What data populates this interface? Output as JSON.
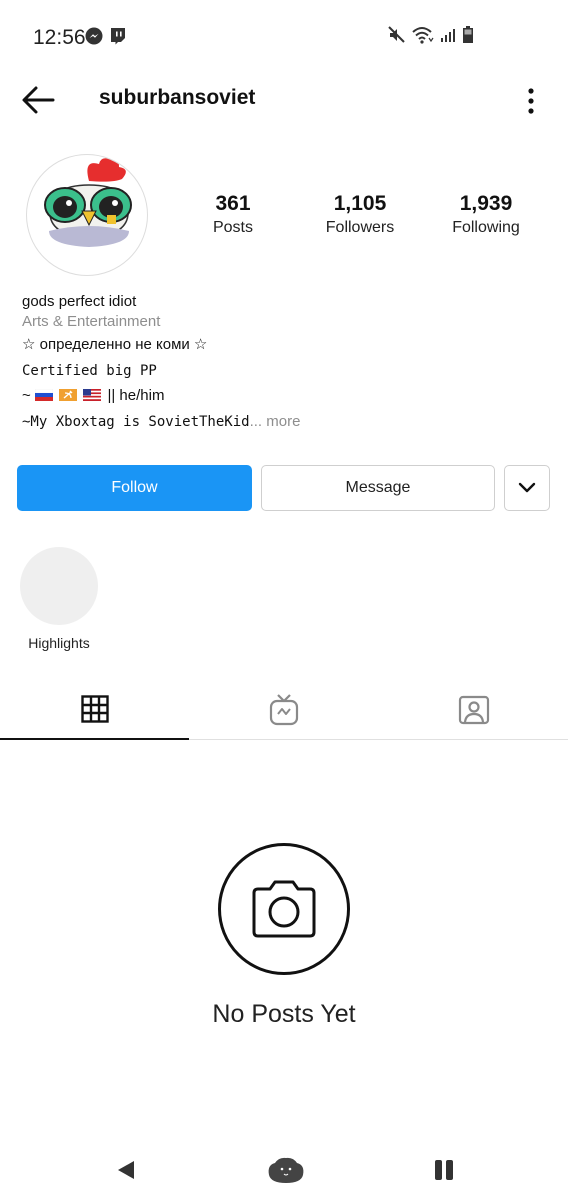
{
  "status_bar": {
    "time": "12:56",
    "left_icons": [
      "messenger-icon",
      "twitch-icon"
    ],
    "right_icons": [
      "mute-icon",
      "wifi-icon",
      "signal-icon",
      "battery-icon"
    ]
  },
  "header": {
    "username": "suburbansoviet",
    "back_icon": "arrow-left-icon",
    "menu_icon": "more-vertical-icon"
  },
  "profile": {
    "stats": [
      {
        "value": "361",
        "label": "Posts"
      },
      {
        "value": "1,105",
        "label": "Followers"
      },
      {
        "value": "1,939",
        "label": "Following"
      }
    ],
    "bio": {
      "name": "gods perfect idiot",
      "category": "Arts & Entertainment",
      "line1": "☆ определенно не коми ☆",
      "line2": "Certified big PP",
      "line3_prefix": "~",
      "line3_suffix": "|| he/him",
      "line4": "~My Xboxtag is SovietTheKid",
      "more": "... more"
    }
  },
  "actions": {
    "follow_label": "Follow",
    "message_label": "Message",
    "dropdown_icon": "chevron-down-icon"
  },
  "highlights": [
    {
      "label": "Highlights"
    }
  ],
  "tabs": [
    {
      "icon": "grid-icon",
      "active": true
    },
    {
      "icon": "igtv-icon",
      "active": false
    },
    {
      "icon": "tagged-icon",
      "active": false
    }
  ],
  "empty_state": {
    "icon": "camera-icon",
    "text": "No Posts Yet"
  },
  "navbar": {
    "icons": [
      "back-triangle-icon",
      "home-blob-icon",
      "recents-icon"
    ]
  },
  "colors": {
    "follow_blue": "#1a95f5",
    "muted_gray": "#8e8e8e",
    "border_gray": "#cfcfcf"
  }
}
